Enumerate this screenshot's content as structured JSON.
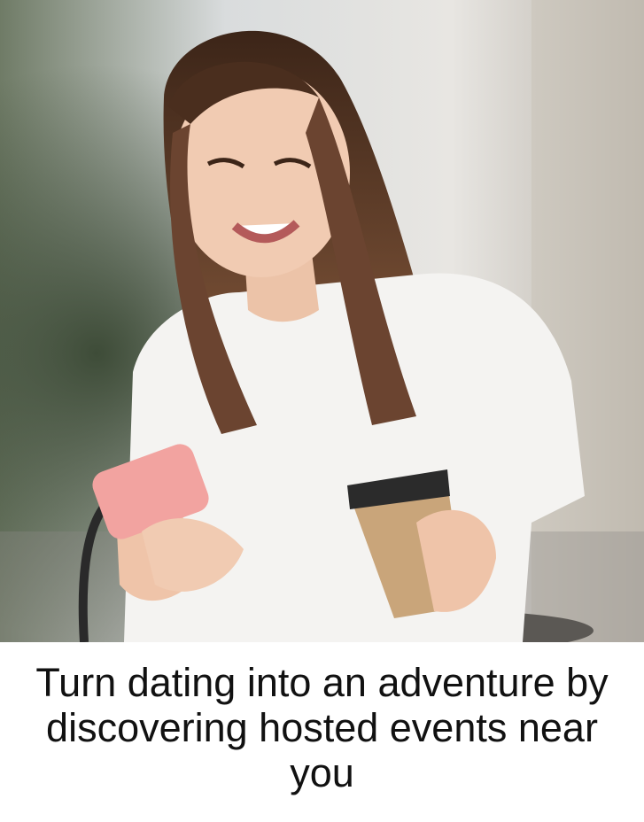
{
  "hero": {
    "alt": "Woman smiling at her phone while holding a coffee cup"
  },
  "caption": {
    "text": "Turn dating into an adventure by discovering hosted events near you"
  },
  "colors": {
    "background": "#ffffff",
    "text": "#111111",
    "shirt": "#f4f3f1",
    "hair": "#5a3a28",
    "phone": "#f2a3a0",
    "cup": "#c9a57a"
  }
}
